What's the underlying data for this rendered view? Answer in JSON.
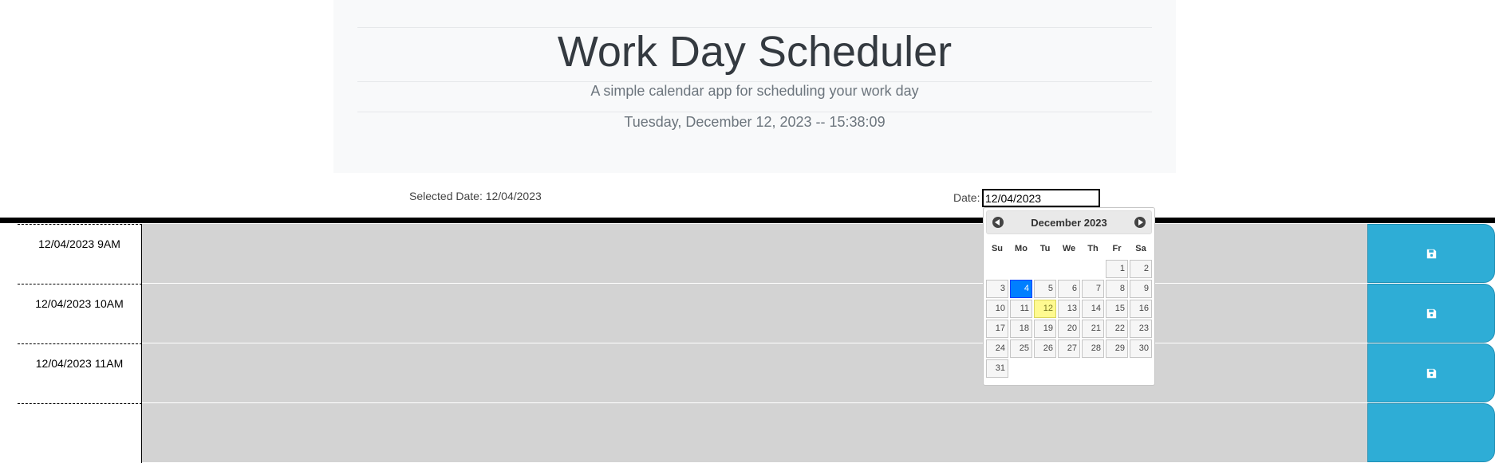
{
  "header": {
    "title": "Work Day Scheduler",
    "lead": "A simple calendar app for scheduling your work day",
    "current_day": "Tuesday, December 12, 2023 -- 15:38:09"
  },
  "date_select": {
    "selected_text": "Selected Date: 12/04/2023",
    "label": "Date:",
    "value": "12/04/2023"
  },
  "time_blocks": [
    {
      "hour": "12/04/2023 9AM",
      "text": "",
      "save_icon": "save-icon"
    },
    {
      "hour": "12/04/2023 10AM",
      "text": "",
      "save_icon": "save-icon"
    },
    {
      "hour": "12/04/2023 11AM",
      "text": "",
      "save_icon": "save-icon"
    },
    {
      "hour": "",
      "text": "",
      "save_icon": "save-icon"
    }
  ],
  "datepicker": {
    "month_title": "December 2023",
    "prev_icon": "circle-triangle-left-icon",
    "next_icon": "circle-triangle-right-icon",
    "weekdays": [
      "Su",
      "Mo",
      "Tu",
      "We",
      "Th",
      "Fr",
      "Sa"
    ],
    "weeks": [
      [
        "",
        "",
        "",
        "",
        "",
        "1",
        "2"
      ],
      [
        "3",
        "4",
        "5",
        "6",
        "7",
        "8",
        "9"
      ],
      [
        "10",
        "11",
        "12",
        "13",
        "14",
        "15",
        "16"
      ],
      [
        "17",
        "18",
        "19",
        "20",
        "21",
        "22",
        "23"
      ],
      [
        "24",
        "25",
        "26",
        "27",
        "28",
        "29",
        "30"
      ],
      [
        "31",
        "",
        "",
        "",
        "",
        "",
        ""
      ]
    ],
    "selected_day": "4",
    "today": "12"
  },
  "colors": {
    "jumbotron_bg": "#f8f9fa",
    "block_bg": "#d3d3d3",
    "save_button": "#2eadd6",
    "selected_day": "#007fff",
    "today_day": "#fffa90"
  }
}
